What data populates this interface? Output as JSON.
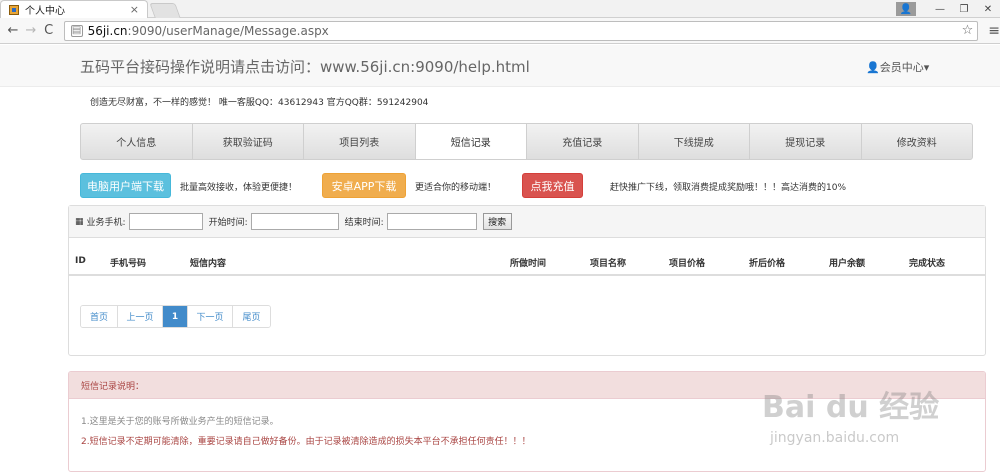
{
  "browser": {
    "tab_title": "个人中心",
    "tab_close": "×",
    "url_host": "56ji.cn",
    "url_rest": ":9090/userManage/Message.aspx",
    "back": "←",
    "forward": "→",
    "reload": "C",
    "star": "☆",
    "menu": "≡",
    "minimize": "—",
    "restore": "❐",
    "close": "✕",
    "user_badge": "👤"
  },
  "header": {
    "title": "五码平台接码操作说明请点击访问：www.56ji.cn:9090/help.html",
    "member_center": "👤会员中心▾",
    "tagline": "创造无尽财富，不一样的感觉！  唯一客服QQ：43612943  官方QQ群：591242904"
  },
  "nav_tabs": [
    {
      "label": "个人信息"
    },
    {
      "label": "获取验证码"
    },
    {
      "label": "项目列表"
    },
    {
      "label": "短信记录"
    },
    {
      "label": "充值记录"
    },
    {
      "label": "下线提成"
    },
    {
      "label": "提现记录"
    },
    {
      "label": "修改资料"
    }
  ],
  "actions": {
    "pc_download": "电脑用户端下载",
    "pc_text": "批量高效接收，体验更便捷！",
    "android_download": "安卓APP下载",
    "android_text": "更适合你的移动端！",
    "recharge": "点我充值",
    "recharge_text": "赶快推广下线，领取消费提成奖励哦！！！高达消费的10%"
  },
  "filter": {
    "icon": "▦",
    "phone_label": "业务手机:",
    "start_label": "开始时间:",
    "end_label": "结束时间:",
    "search_label": "搜索"
  },
  "table": {
    "columns": [
      "ID",
      "手机号码",
      "短信内容",
      "所做时间",
      "项目名称",
      "项目价格",
      "折后价格",
      "用户余额",
      "完成状态"
    ]
  },
  "pager": {
    "first": "首页",
    "prev": "上一页",
    "current": "1",
    "next": "下一页",
    "last": "尾页"
  },
  "notice": {
    "heading": "短信记录说明：",
    "line1": "1.这里是关于您的账号所做业务产生的短信记录。",
    "line2": "2.短信记录不定期可能清除，重要记录请自己做好备份。由于记录被清除造成的损失本平台不承担任何责任！！！"
  },
  "watermark": {
    "logo": "Bai du 经验",
    "url": "jingyan.baidu.com"
  }
}
